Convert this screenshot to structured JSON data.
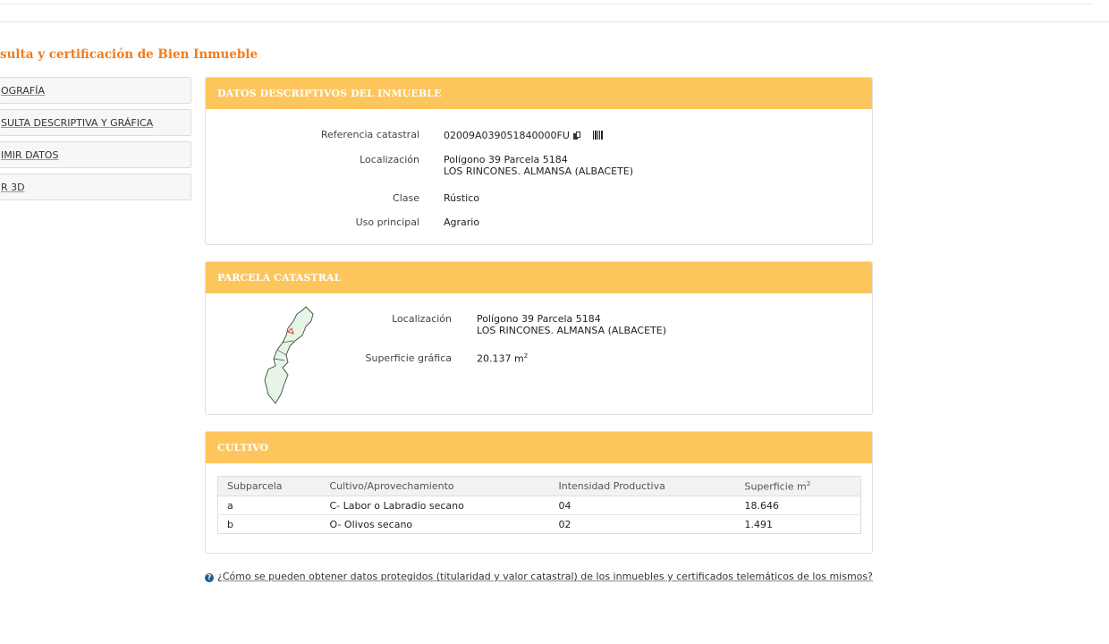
{
  "page": {
    "title": "sulta y certificación de Bien Inmueble"
  },
  "sidebar": {
    "items": [
      {
        "label": "OGRAFÍA"
      },
      {
        "label": "SULTA DESCRIPTIVA Y GRÁFICA"
      },
      {
        "label": "IMIR DATOS"
      },
      {
        "label": "R 3D"
      }
    ]
  },
  "descriptive": {
    "header": "DATOS DESCRIPTIVOS DEL INMUEBLE",
    "ref_label": "Referencia catastral",
    "ref_value": "02009A039051840000FU",
    "loc_label": "Localización",
    "loc_line1": "Polígono 39 Parcela 5184",
    "loc_line2": "LOS RINCONES. ALMANSA (ALBACETE)",
    "class_label": "Clase",
    "class_value": "Rústico",
    "use_label": "Uso principal",
    "use_value": "Agrario"
  },
  "parcel": {
    "header": "PARCELA CATASTRAL",
    "loc_label": "Localización",
    "loc_line1": "Polígono 39 Parcela 5184",
    "loc_line2": "LOS RINCONES. ALMANSA (ALBACETE)",
    "surface_label": "Superficie gráfica",
    "surface_value": "20.137 m",
    "surface_unit_sup": "2"
  },
  "crop": {
    "header": "CULTIVO",
    "columns": [
      "Subparcela",
      "Cultivo/Aprovechamiento",
      "Intensidad Productiva",
      "Superficie m"
    ],
    "columns_sup": "2",
    "rows": [
      [
        "a",
        "C- Labor o Labradío secano",
        "04",
        "18.646"
      ],
      [
        "b",
        "O- Olivos secano",
        "02",
        "1.491"
      ]
    ]
  },
  "footer": {
    "link_text": "¿Cómo se pueden obtener datos protegidos (titularidad y valor catastral) de los inmuebles y certificados telemáticos de los mismos?"
  },
  "colors": {
    "accent": "#f07c1c",
    "panel_header": "#fdc65d"
  }
}
